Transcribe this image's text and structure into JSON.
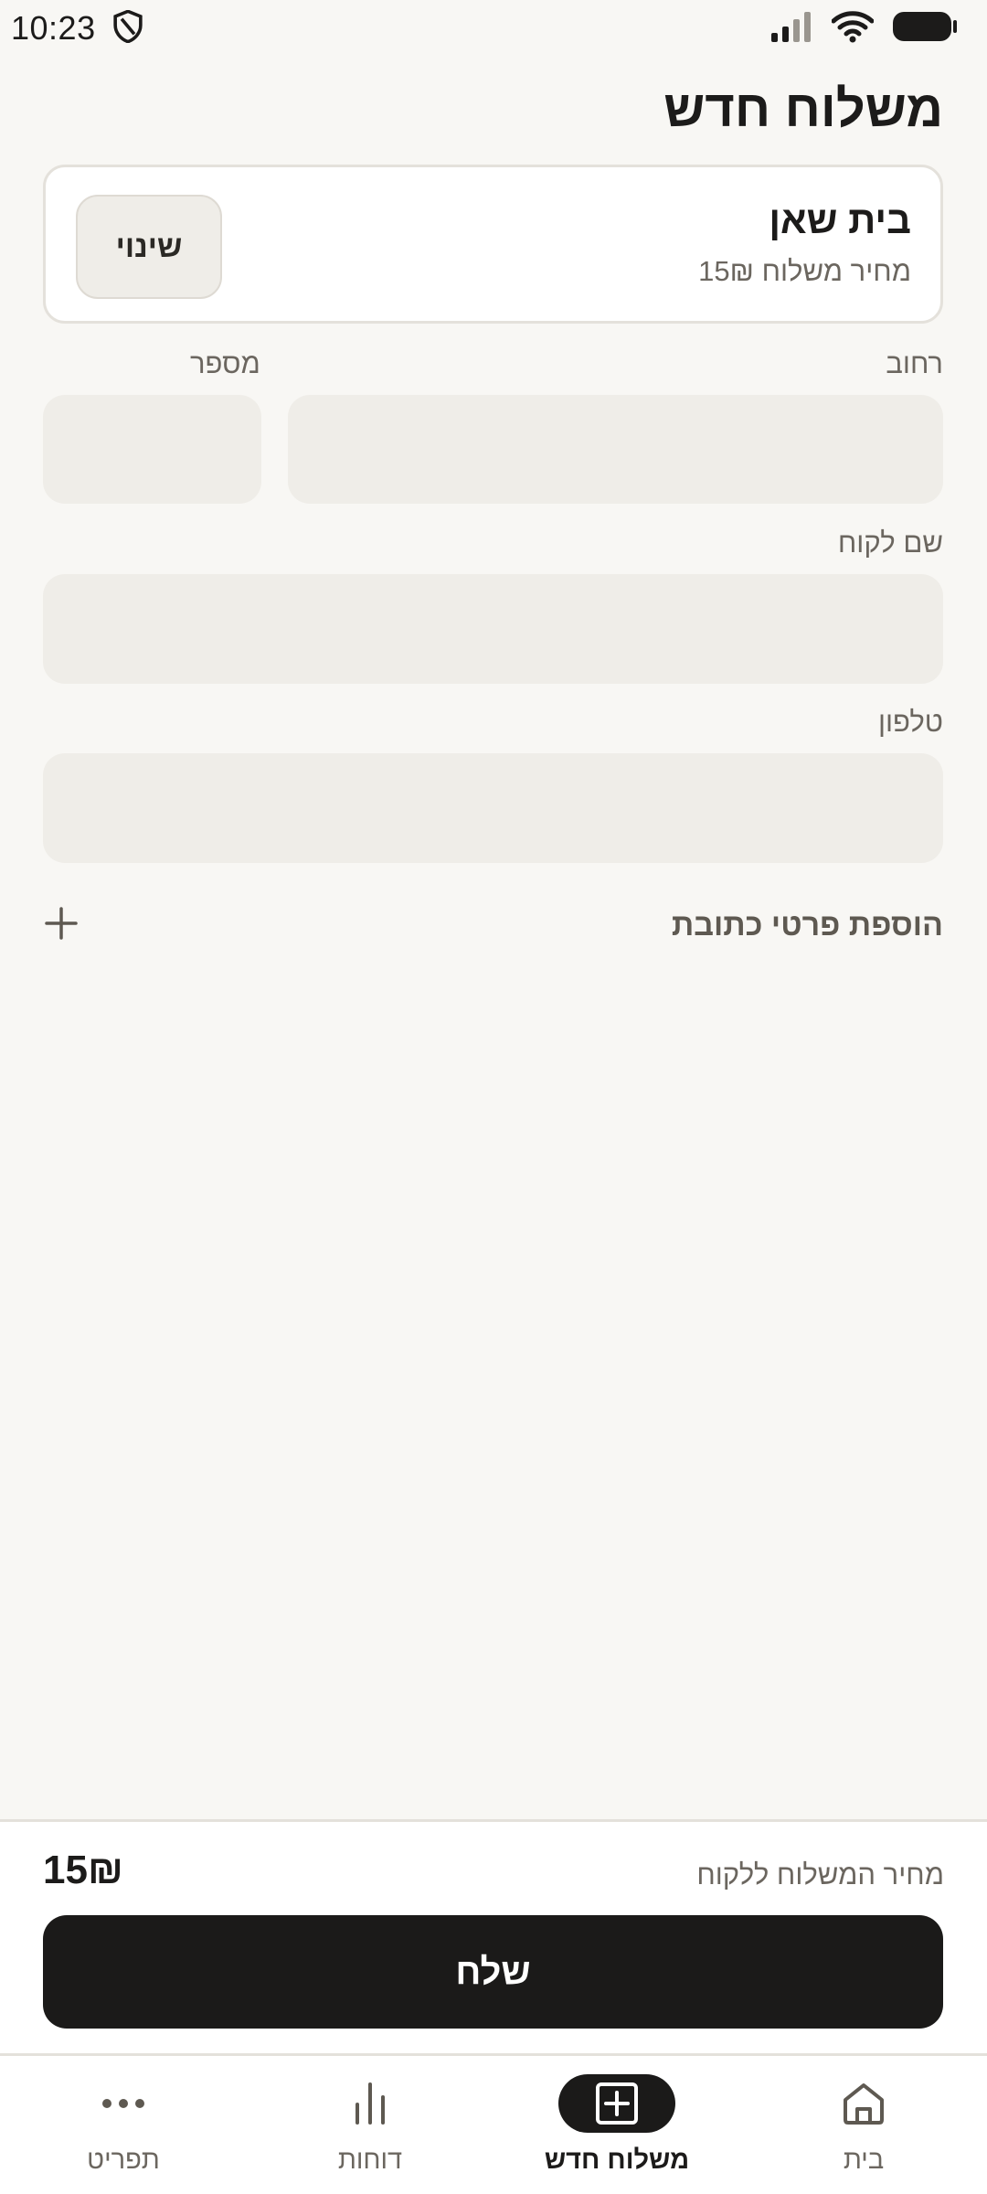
{
  "status_bar": {
    "time": "10:23"
  },
  "header": {
    "title": "משלוח חדש"
  },
  "branch": {
    "name": "בית שאן",
    "price_text": "מחיר משלוח 15₪",
    "change_label": "שינוי"
  },
  "form": {
    "street_label": "רחוב",
    "street_value": "",
    "number_label": "מספר",
    "number_value": "",
    "customer_name_label": "שם לקוח",
    "customer_name_value": "",
    "phone_label": "טלפון",
    "phone_value": "",
    "add_address_details_label": "הוספת פרטי כתובת"
  },
  "summary": {
    "label": "מחיר המשלוח ללקוח",
    "value": "15₪",
    "send_label": "שלח"
  },
  "bottom_nav": {
    "items": [
      {
        "label": "בית",
        "icon": "home-icon",
        "active": false
      },
      {
        "label": "משלוח חדש",
        "icon": "add-box-icon",
        "active": true
      },
      {
        "label": "דוחות",
        "icon": "bar-chart-icon",
        "active": false
      },
      {
        "label": "תפריט",
        "icon": "more-horizontal-icon",
        "active": false
      }
    ]
  },
  "colors": {
    "background": "#f8f7f4",
    "field_fill": "#efede8",
    "primary_button": "#1b1a19",
    "muted_text": "#6b665f"
  }
}
